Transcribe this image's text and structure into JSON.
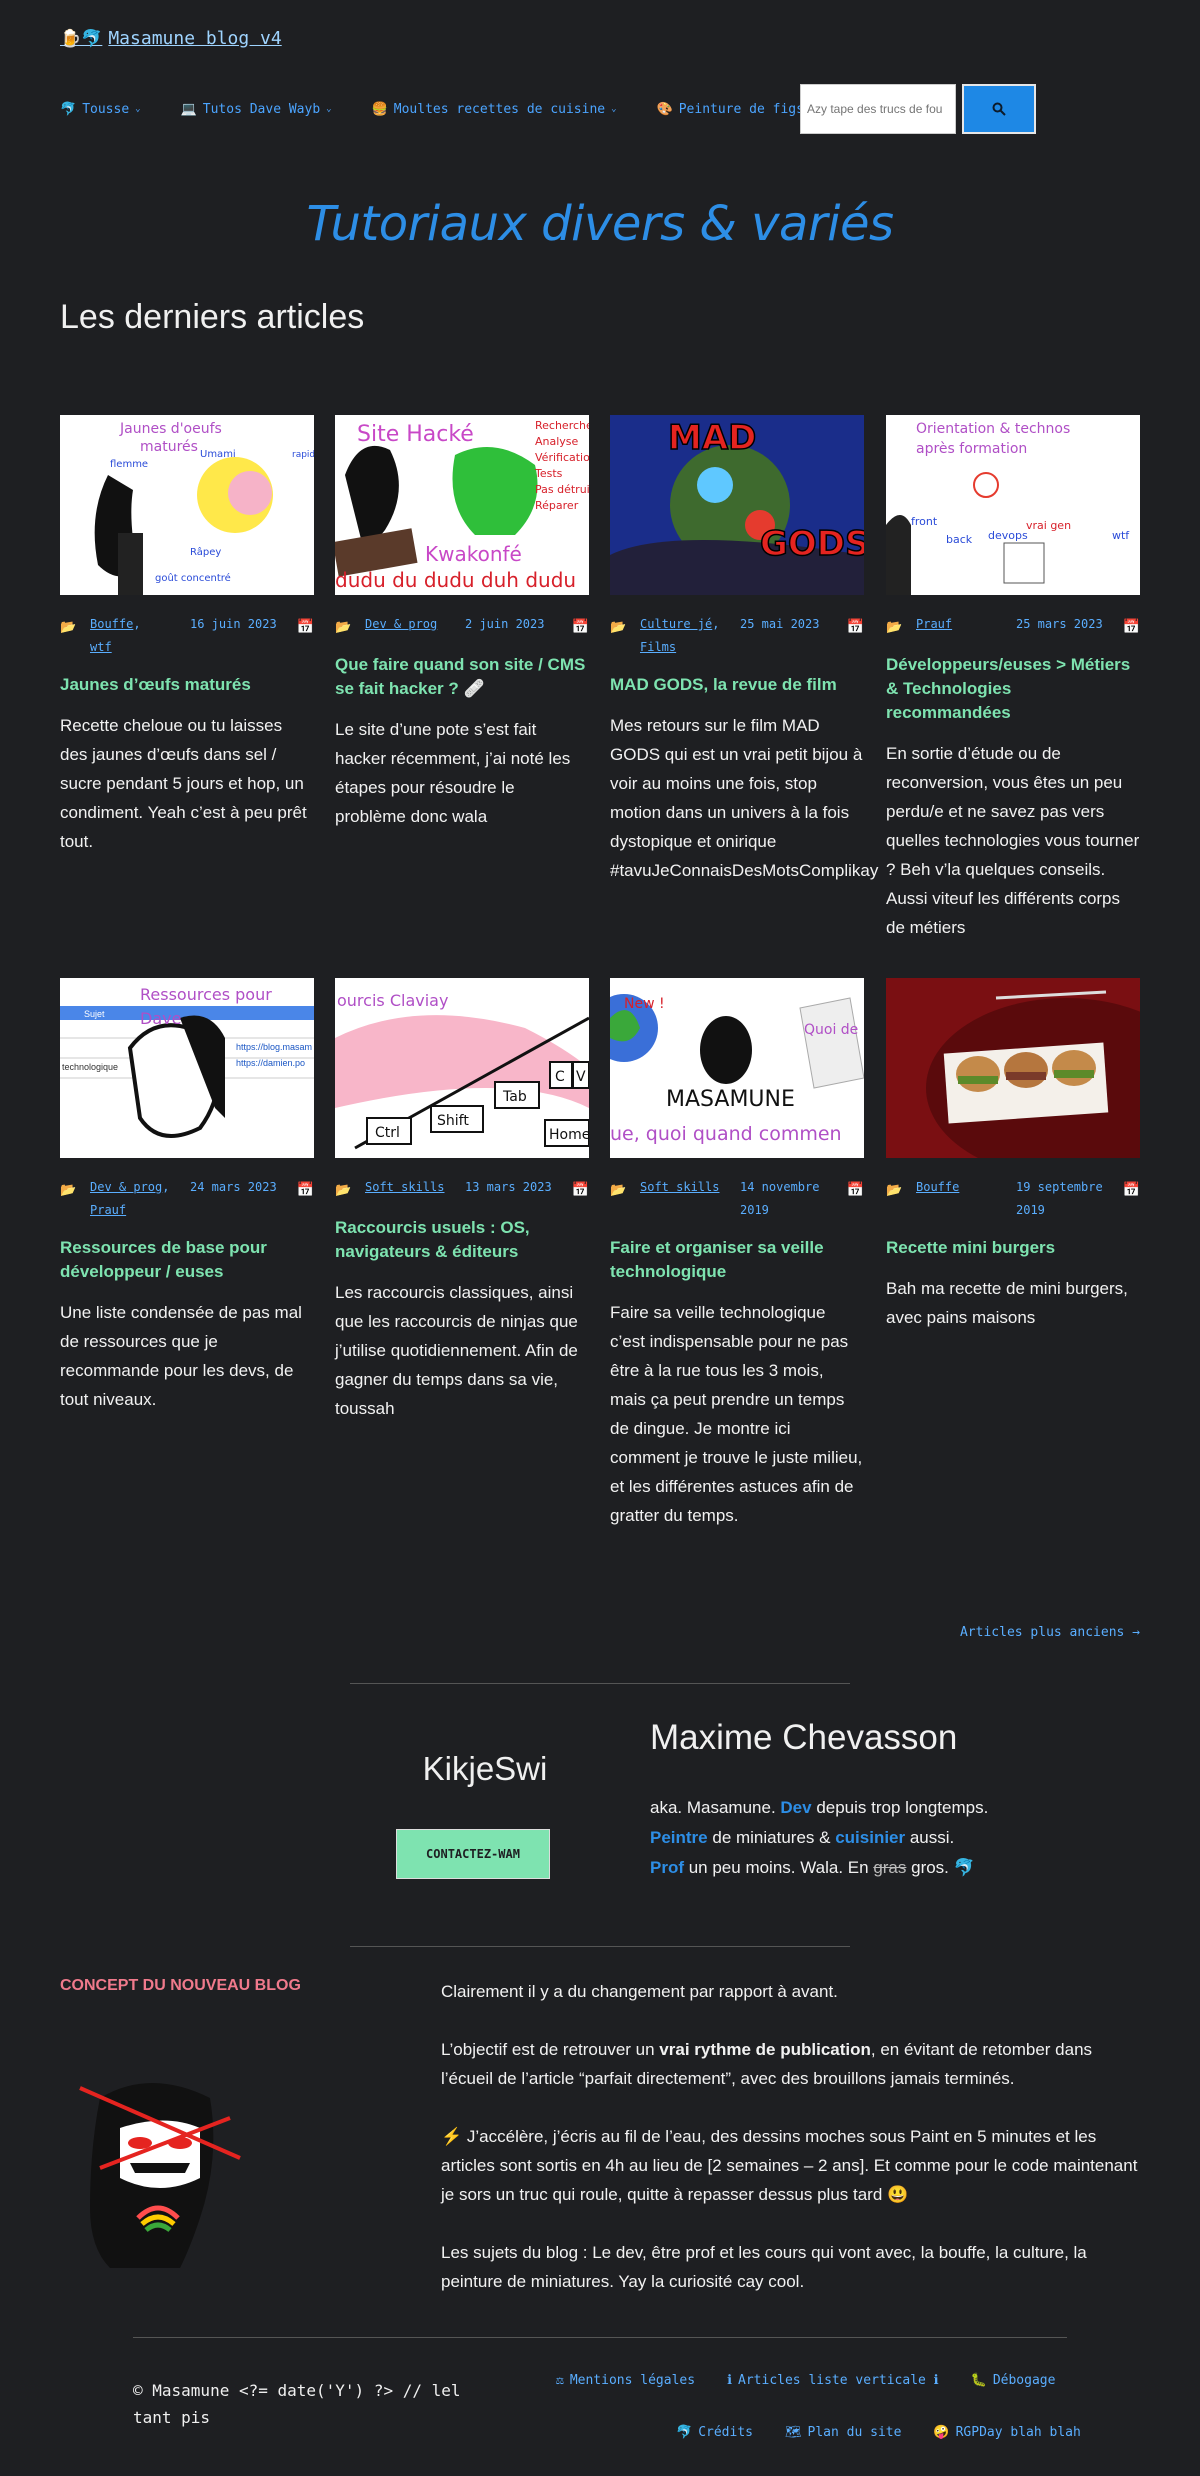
{
  "site": {
    "title": "Masamune blog v4",
    "logo_icons": "🍺🐬"
  },
  "nav": [
    {
      "icon": "🐬",
      "label": "Tousse"
    },
    {
      "icon": "💻",
      "label": "Tutos Dave Wayb"
    },
    {
      "icon": "🍔",
      "label": "Moultes recettes de cuisine"
    },
    {
      "icon": "🎨",
      "label": "Peinture de figs"
    }
  ],
  "search": {
    "placeholder": "Azy tape des trucs de fou"
  },
  "hero": {
    "title": "Tutoriaux divers & variés"
  },
  "latest": {
    "title": "Les derniers articles"
  },
  "posts": [
    {
      "thumb_text": [
        "Jaunes d'oeufs",
        "maturés",
        "Umami",
        "flemme",
        "Râpey",
        "goût concentré"
      ],
      "cats": [
        "Bouffe",
        "wtf"
      ],
      "date": "16 juin 2023",
      "title": "Jaunes d’œufs maturés",
      "excerpt": "Recette cheloue ou tu laisses des jaunes d’œufs dans sel / sucre pendant 5 jours et hop, un condiment. Yeah c’est à peu prêt tout."
    },
    {
      "thumb_text": [
        "Site Hacké",
        "Recherche",
        "Analyse",
        "Vérification",
        "Tests",
        "Pas détruire",
        "Réparer",
        "Kwakonfé",
        "dudu du dudu duh dudu"
      ],
      "cats": [
        "Dev & prog"
      ],
      "date": "2 juin 2023",
      "title": "Que faire quand son site / CMS se fait hacker ? 🩹",
      "excerpt": "Le site d’une pote s’est fait hacker récemment, j’ai noté les étapes pour résoudre le problème donc wala"
    },
    {
      "thumb_text": [
        "MAD",
        "GODS"
      ],
      "cats": [
        "Culture jé",
        "Films"
      ],
      "date": "25 mai 2023",
      "title": "MAD GODS, la revue de film",
      "excerpt": "Mes retours sur le film MAD GODS qui est un vrai petit bijou à voir au moins une fois, stop motion dans un univers à la fois dystopique et onirique #tavuJeConnaisDesMotsComplikay"
    },
    {
      "thumb_text": [
        "Orientation & technos",
        "après formation",
        "front",
        "back",
        "devops",
        "vrai gen",
        "wtf"
      ],
      "cats": [
        "Prauf"
      ],
      "date": "25 mars 2023",
      "title": "Développeurs/euses > Métiers & Technologies recommandées",
      "excerpt": "En sortie d’étude ou de reconversion, vous êtes un peu perdu/e et ne savez pas vers quelles technologies vous tourner ? Beh v’la quelques conseils. Aussi viteuf les différents corps de métiers"
    },
    {
      "thumb_text": [
        "Ressources pour",
        "Dave",
        "Sujet",
        "technologique",
        "https://blog.masam",
        "https://damien.po"
      ],
      "cats": [
        "Dev & prog",
        "Prauf"
      ],
      "date": "24 mars 2023",
      "title": "Ressources de base pour développeur / euses",
      "excerpt": "Une liste condensée de pas mal de ressources que je recommande pour les devs, de tout niveaux."
    },
    {
      "thumb_text": [
        "ourcis Claviay",
        "Ctrl",
        "Shift",
        "Tab",
        "C",
        "V",
        "Home"
      ],
      "cats": [
        "Soft skills"
      ],
      "date": "13 mars 2023",
      "title": "Raccourcis usuels : OS, navigateurs & éditeurs",
      "excerpt": "Les raccourcis classiques, ainsi que les raccourcis de ninjas que j’utilise quotidiennement. Afin de gagner du temps dans sa vie, toussah"
    },
    {
      "thumb_text": [
        "New !",
        "Quoi de",
        "MASAMUNE",
        "ue, quoi quand commen"
      ],
      "cats": [
        "Soft skills"
      ],
      "date": "14 novembre 2019",
      "title": "Faire et organiser sa veille technologique",
      "excerpt": "Faire sa veille technologique c’est indispensable pour ne pas être à la rue tous les 3 mois, mais ça peut prendre un temps de dingue. Je montre ici comment je trouve le juste milieu, et les différentes astuces afin de gratter du temps."
    },
    {
      "thumb_text": [],
      "cats": [
        "Bouffe"
      ],
      "date": "19 septembre 2019",
      "title": "Recette mini burgers",
      "excerpt": "Bah ma recette de mini burgers, avec pains maisons"
    }
  ],
  "pagination": {
    "older": "Articles plus anciens →"
  },
  "contact": {
    "name": "KikjeSwi",
    "button": "CONTACTEZ-WAM"
  },
  "author": {
    "name": "Maxime Chevasson",
    "bio": [
      {
        "parts": [
          [
            "aka. Masamune. ",
            ""
          ],
          [
            "Dev",
            "hl"
          ],
          [
            " depuis trop longtemps.",
            ""
          ]
        ]
      },
      {
        "parts": [
          [
            "Peintre",
            "hl"
          ],
          [
            " de miniatures & ",
            ""
          ],
          [
            "cuisinier",
            "hl"
          ],
          [
            " aussi.",
            ""
          ]
        ]
      },
      {
        "parts": [
          [
            "Prof",
            "hl"
          ],
          [
            " un peu moins. Wala. En ",
            ""
          ],
          [
            "gras",
            "s"
          ],
          [
            " gros. 🐬",
            ""
          ]
        ]
      }
    ]
  },
  "concept": {
    "title": "CONCEPT DU NOUVEAU BLOG",
    "paragraphs": [
      [
        [
          "Clairement il y a du changement par rapport à avant.",
          ""
        ]
      ],
      [
        [
          "L’objectif est de retrouver un ",
          ""
        ],
        [
          "vrai rythme de publication",
          "b"
        ],
        [
          ", en évitant de retomber dans l’écueil de l’article “parfait directement”, avec des brouillons jamais terminés.",
          ""
        ]
      ],
      [
        [
          "⚡ J’accélère, j’écris au fil de l’eau, des dessins moches sous Paint en 5 minutes et les articles sont sortis en 4h au lieu de [2 semaines – 2 ans]. Et comme pour le code maintenant je sors un truc qui roule, quitte à repasser dessus plus tard 😃",
          ""
        ]
      ],
      [
        [
          "Les sujets du blog : Le dev, être prof et les cours qui vont avec, la bouffe, la culture, la peinture de miniatures. Yay la curiosité cay cool.",
          ""
        ]
      ]
    ]
  },
  "footer": {
    "copyright": "© Masamune <?= date('Y') ?> // lel tant pis",
    "links_row1": [
      {
        "icon": "⚖",
        "label": "Mentions légales"
      },
      {
        "icon": "ℹ",
        "label": "Articles liste verticale ℹ"
      },
      {
        "icon": "🐛",
        "label": "Débogage"
      }
    ],
    "links_row2": [
      {
        "icon": "🐬",
        "label": "Crédits"
      },
      {
        "icon": "🗺",
        "label": "Plan du site"
      },
      {
        "icon": "🤪",
        "label": "RGPDay blah blah"
      }
    ]
  },
  "colors": {
    "background": "#1e1f22",
    "accent": "#2d8ee6",
    "link": "#5aaeff",
    "title_green": "#7ee3b0",
    "concept_pink": "#f07a8c"
  }
}
